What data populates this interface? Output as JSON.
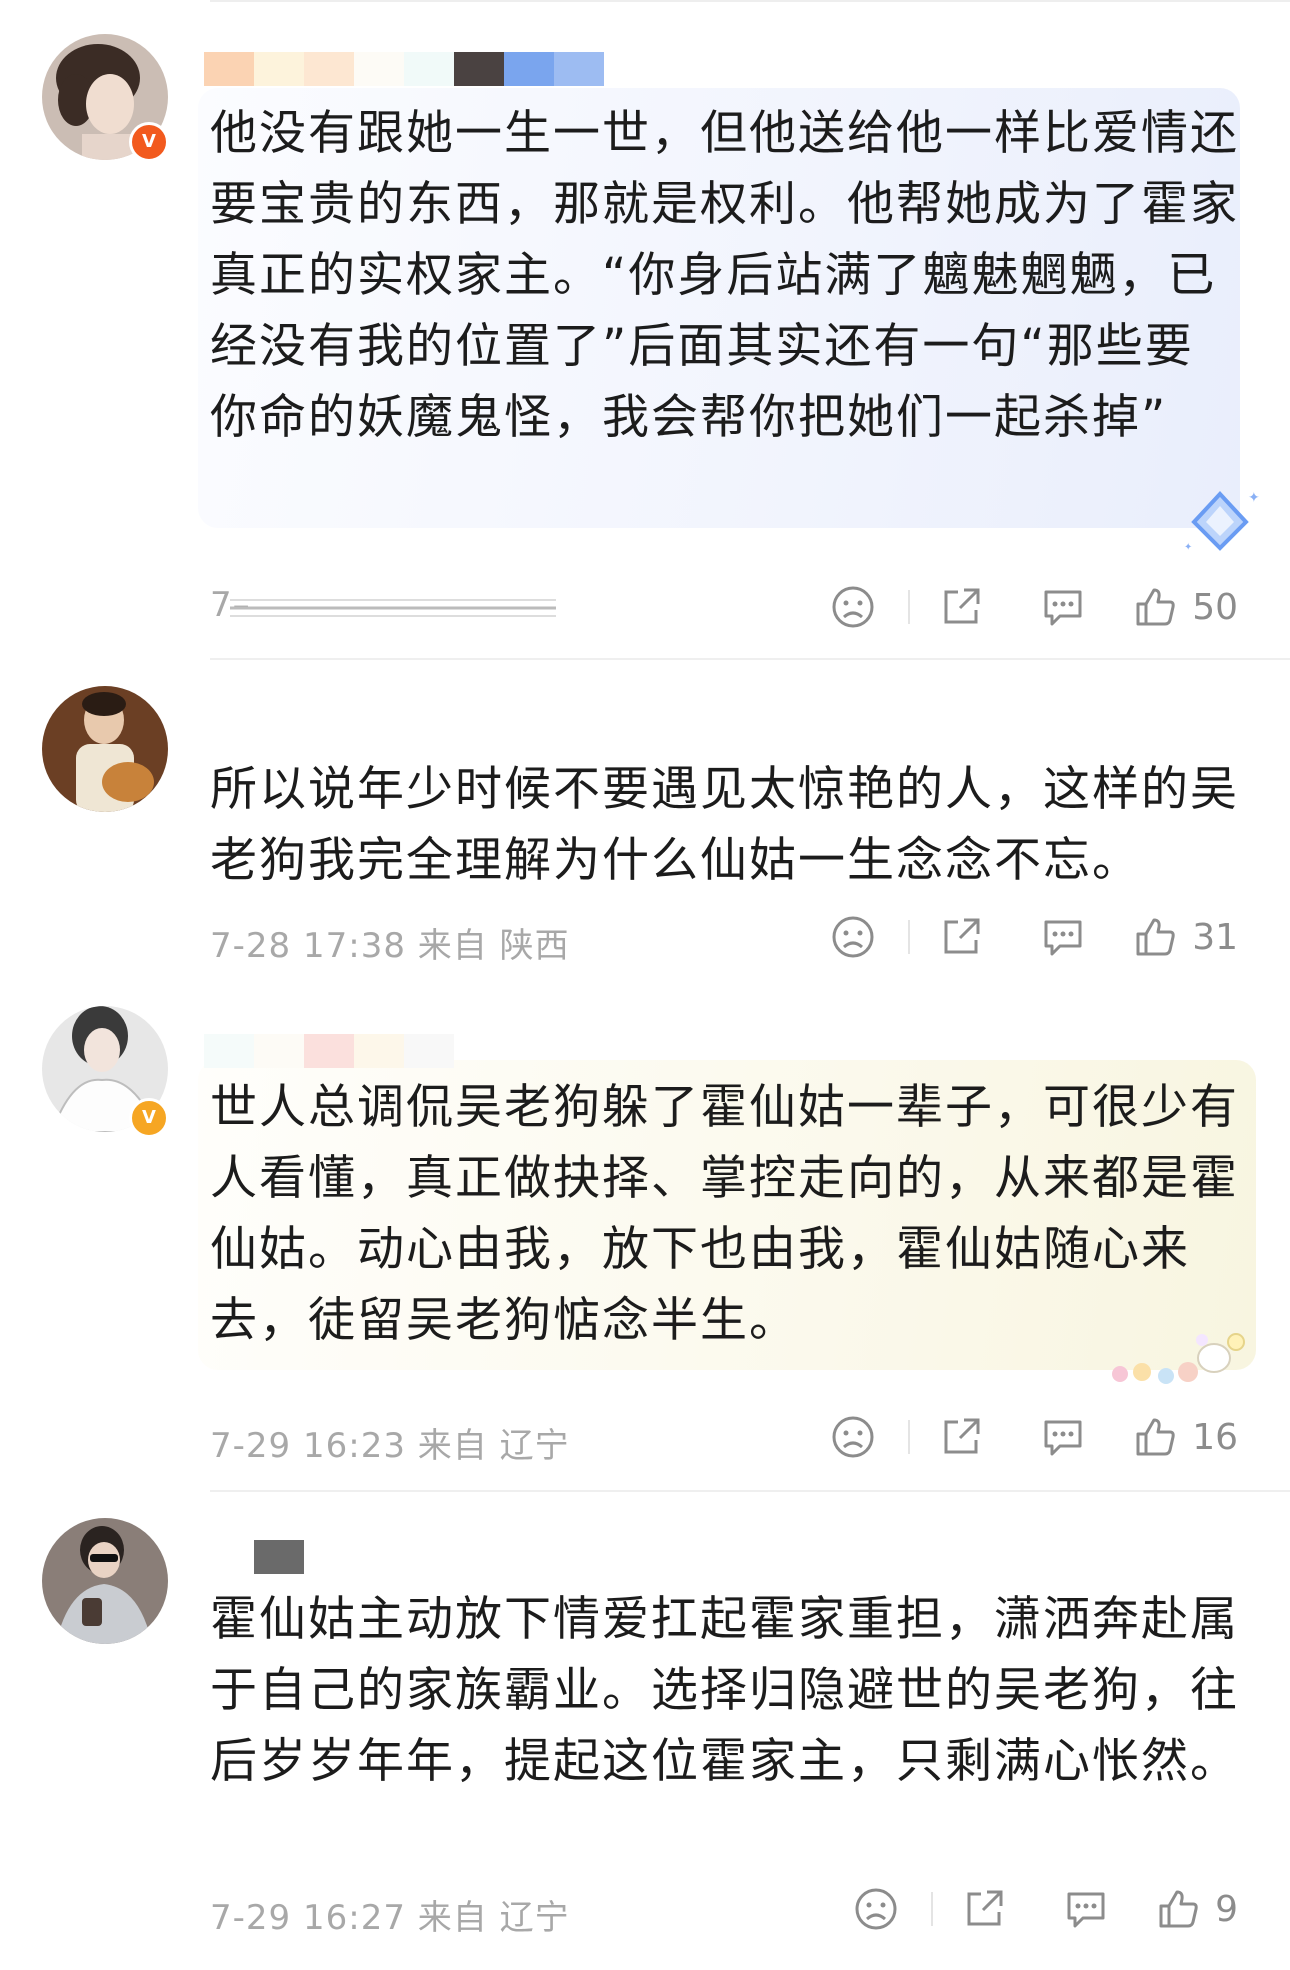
{
  "comments": [
    {
      "text": "他没有跟她一生一世，但他送给他一样比爱情还要宝贵的东西，那就是权利。他帮她成为了霍家真正的实权家主。“你身后站满了魑魅魍魉，已经没有我的位置了”后面其实还有一句“那些要你命的妖魔鬼怪，我会帮你把她们一起杀掉”",
      "meta": "7–",
      "likes": "50",
      "badge": "V"
    },
    {
      "text": "所以说年少时候不要遇见太惊艳的人，这样的吴老狗我完全理解为什么仙姑一生念念不忘。",
      "meta": "7-28 17:38 来自 陕西",
      "likes": "31"
    },
    {
      "text": "世人总调侃吴老狗躲了霍仙姑一辈子，可很少有人看懂，真正做抉择、掌控走向的，从来都是霍仙姑。动心由我，放下也由我，霍仙姑随心来去，徒留吴老狗惦念半生。",
      "meta": "7-29 16:23 来自 辽宁",
      "likes": "16",
      "badge": "V"
    },
    {
      "text": "霍仙姑主动放下情爱扛起霍家重担，潇洒奔赴属于自己的家族霸业。选择归隐避世的吴老狗，往后岁岁年年，提起这位霍家主，只剩满心怅然。",
      "meta": "7-29 16:27 来自 辽宁",
      "likes": "9"
    }
  ],
  "colors": {
    "text": "#1c1c1c",
    "meta": "#a8a8a8",
    "icon": "#8c8c8c",
    "bubble_blue": "#eef2fd",
    "bubble_yellow": "#fbf8e8",
    "badge_orange": "#f6a623",
    "badge_red": "#f25a1e"
  },
  "icons": [
    "sad-face-icon",
    "share-icon",
    "comment-icon",
    "thumbs-up-icon"
  ]
}
